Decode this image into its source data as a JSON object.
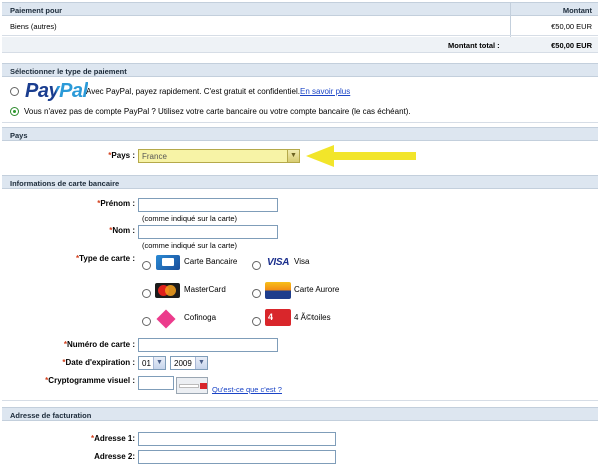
{
  "summary": {
    "col_desc": "Paiement pour",
    "col_amount": "Montant",
    "item_desc": "Biens (autres)",
    "item_amount": "€50,00 EUR",
    "total_label": "Montant total :",
    "total_amount": "€50,00 EUR"
  },
  "payment": {
    "section_title": "Sélectionner le type de paiement",
    "paypal_logo": "PayPal",
    "paypal_text": "Avec PayPal, payez rapidement. C'est gratuit et confidentiel.",
    "paypal_link": "En savoir plus",
    "card_text": "Vous n'avez pas de compte PayPal ? Utilisez votre carte bancaire ou votre compte bancaire (le cas échéant)."
  },
  "country": {
    "section_title": "Pays",
    "label": "Pays :",
    "value": "France"
  },
  "card_info": {
    "section_title": "Informations de carte bancaire",
    "firstname_label": "Prénom :",
    "firstname_hint": "(comme indiqué sur la carte)",
    "lastname_label": "Nom :",
    "lastname_hint": "(comme indiqué sur la carte)",
    "type_label": "Type de carte :",
    "types": [
      "Carte Bancaire",
      "Visa",
      "MasterCard",
      "Carte Aurore",
      "Cofinoga",
      "4 Ã©toiles"
    ],
    "number_label": "Numéro de carte :",
    "expiry_label": "Date d'expiration :",
    "expiry_month": "01",
    "expiry_year": "2009",
    "cvv_label": "Cryptogramme visuel :",
    "cvv_link": "Qu'est-ce que c'est ?"
  },
  "billing": {
    "section_title": "Adresse de facturation",
    "address1_label": "Adresse 1:",
    "address2_label": "Adresse 2:"
  },
  "colors": {
    "header_bg": "#dde6f0",
    "highlight_select": "#f7f3a6",
    "arrow_yellow": "#f2e52a",
    "link": "#1a44c6"
  }
}
